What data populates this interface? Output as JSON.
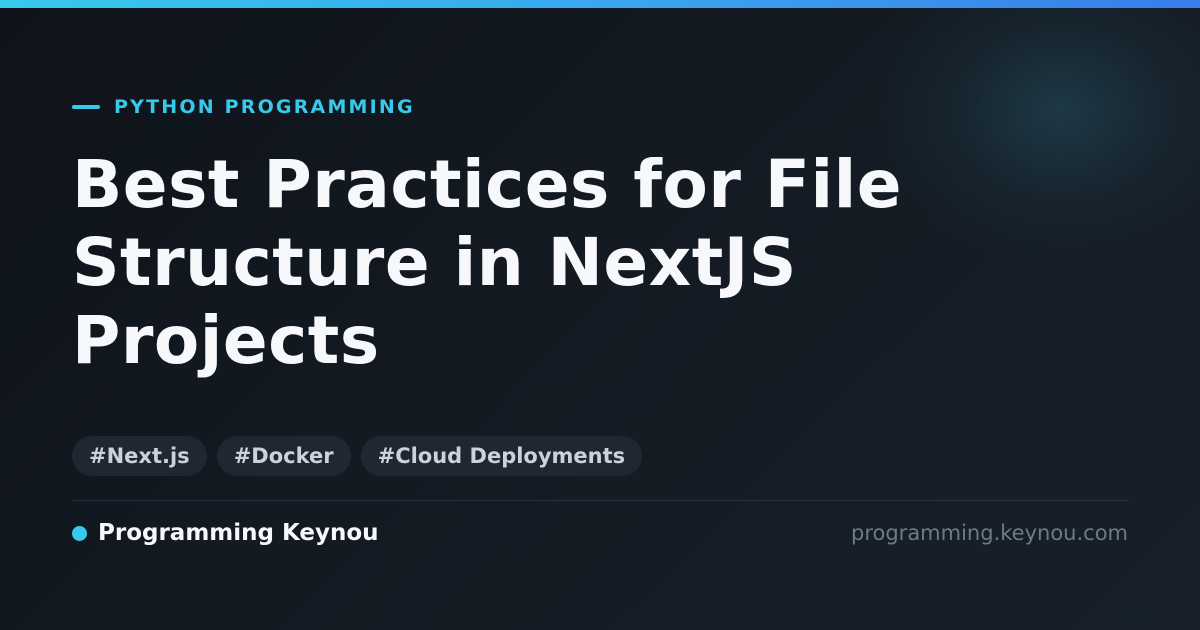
{
  "colors": {
    "accent": "#38c9ea",
    "background": "#131a22",
    "title": "#f6f8fb",
    "tag_background": "#1e2732",
    "tag_text": "#c9d2dd",
    "muted": "#6e7a87"
  },
  "category": "PYTHON PROGRAMMING",
  "title_lines": [
    "Best Practices for File",
    "Structure in NextJS",
    "Projects"
  ],
  "tags": [
    "#Next.js",
    "#Docker",
    "#Cloud Deployments"
  ],
  "footer": {
    "brand_name": "Programming Keynou",
    "site_url": "programming.keynou.com"
  }
}
